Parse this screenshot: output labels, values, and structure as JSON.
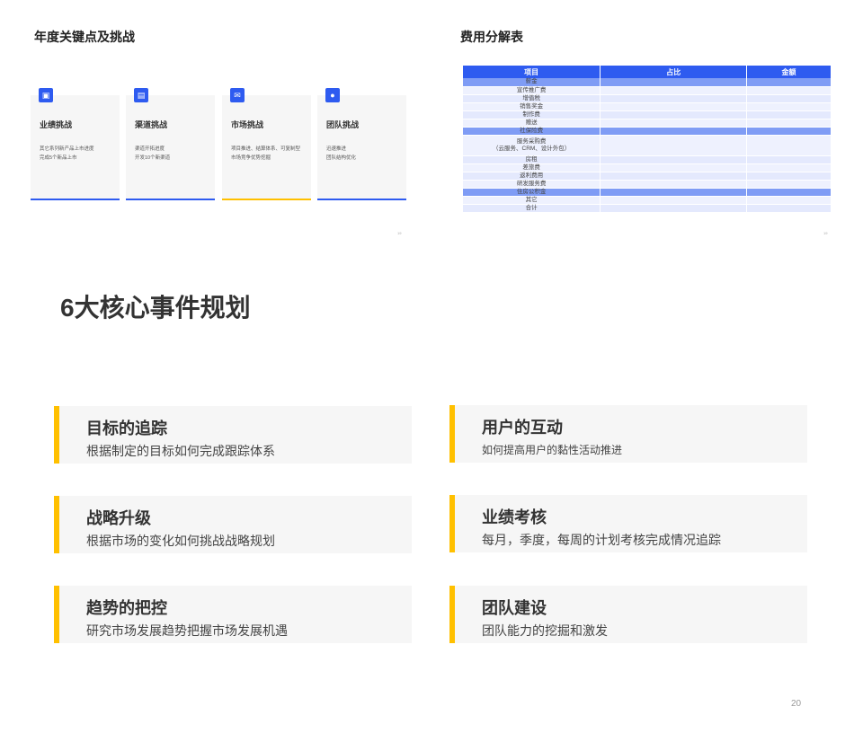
{
  "slide_left": {
    "title": "年度关键点及挑战",
    "page": "19",
    "cards": [
      {
        "title": "业绩挑战",
        "desc1": "其它系列新产品上市进度",
        "desc2": "完成5个新品上市",
        "icon": "image-icon",
        "bar_color": "#2e5bf0"
      },
      {
        "title": "渠道挑战",
        "desc1": "渠道开拓进度",
        "desc2": "开发10个新渠道",
        "icon": "briefcase-icon",
        "bar_color": "#2e5bf0"
      },
      {
        "title": "市场挑战",
        "desc1": "项目推进、结算体系、可复制型",
        "desc2": "市场竞争优势挖掘",
        "icon": "mail-icon",
        "bar_color": "#ffc000"
      },
      {
        "title": "团队挑战",
        "desc1": "迅速推进",
        "desc2": "团队结构优化",
        "icon": "location-icon",
        "bar_color": "#2e5bf0"
      }
    ]
  },
  "slide_right": {
    "title": "费用分解表",
    "page": "19",
    "headers": [
      "项目",
      "占比",
      "金额"
    ],
    "rows": [
      "薪金",
      "宣传推广费",
      "增值税",
      "销售奖金",
      "制作费",
      "赠送",
      "社保险费",
      "服务采购费\n（云服务、CRM、设计外包）",
      "房租",
      "差旅费",
      "返利费用",
      "研发服务费",
      "住房公积金",
      "其它",
      "合计"
    ]
  },
  "main": {
    "title": "6大核心事件规划",
    "page": "20",
    "accent_color": "#ffc000",
    "items": [
      {
        "title": "目标的追踪",
        "desc": "根据制定的目标如何完成跟踪体系"
      },
      {
        "title": "用户的互动",
        "desc": "如何提高用户的黏性活动推进"
      },
      {
        "title": "战略升级",
        "desc": "根据市场的变化如何挑战战略规划"
      },
      {
        "title": "业绩考核",
        "desc": "每月，季度，每周的计划考核完成情况追踪"
      },
      {
        "title": "趋势的把控",
        "desc": "研究市场发展趋势把握市场发展机遇"
      },
      {
        "title": "团队建设",
        "desc": "团队能力的挖掘和激发"
      }
    ]
  }
}
